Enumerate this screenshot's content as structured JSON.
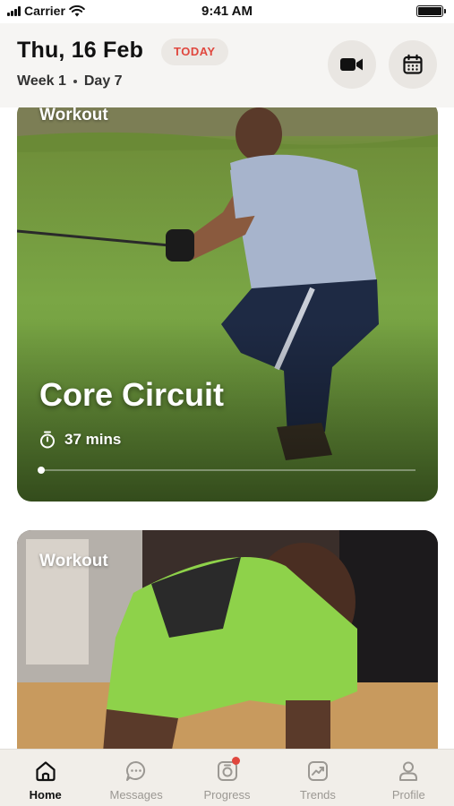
{
  "status_bar": {
    "carrier": "Carrier",
    "time": "9:41 AM"
  },
  "header": {
    "date": "Thu, 16 Feb",
    "today_label": "TODAY",
    "week": "Week 1",
    "day": "Day 7",
    "video_icon": "video-camera-icon",
    "calendar_icon": "calendar-icon"
  },
  "cards": [
    {
      "label": "Workout",
      "title": "Core Circuit",
      "duration": "37 mins",
      "progress": 0.0
    },
    {
      "label": "Workout"
    }
  ],
  "tabs": [
    {
      "label": "Home",
      "icon": "home-icon",
      "active": true
    },
    {
      "label": "Messages",
      "icon": "chat-icon",
      "active": false
    },
    {
      "label": "Progress",
      "icon": "camera-icon",
      "active": false,
      "has_badge": true
    },
    {
      "label": "Trends",
      "icon": "trend-chart-icon",
      "active": false
    },
    {
      "label": "Profile",
      "icon": "person-icon",
      "active": false
    }
  ],
  "colors": {
    "accent": "#e0473e",
    "header_bg": "#f6f5f3",
    "tab_bar_bg": "#f1eee9"
  }
}
